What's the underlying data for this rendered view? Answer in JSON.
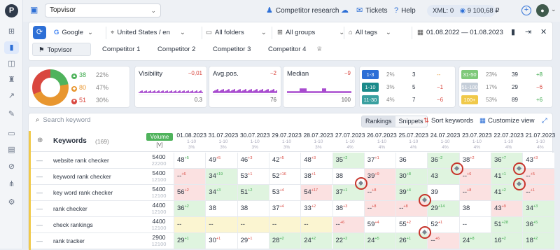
{
  "topbar": {
    "project": "Topvisor",
    "competitor_research": "Competitor research",
    "tickets": "Tickets",
    "help": "Help",
    "xml_label": "XML:",
    "xml_value": "0",
    "balance": "9 100,68 ₽"
  },
  "filters": {
    "engine": "Google",
    "region": "United States / en",
    "folders": "All folders",
    "groups": "All groups",
    "tags": "All tags",
    "date_range": "01.08.2022 — 01.08.2023",
    "competitors": [
      "Topvisor",
      "Competitor 1",
      "Competitor 2",
      "Competitor 3",
      "Competitor 4"
    ]
  },
  "summary": {
    "pie": [
      {
        "label": "38",
        "pct": "22%",
        "color": "#4fb35c"
      },
      {
        "label": "80",
        "pct": "47%",
        "color": "#e8962f"
      },
      {
        "label": "51",
        "pct": "30%",
        "color": "#d9473f"
      }
    ],
    "visibility": {
      "title": "Visibility",
      "delta": "−0,01",
      "value": "0.3"
    },
    "avgpos": {
      "title": "Avg.pos.",
      "delta": "−2",
      "value": "76"
    },
    "median": {
      "title": "Median",
      "delta": "−9",
      "value": "100"
    },
    "ranges_left": [
      {
        "badge": "1-3",
        "pct": "2%",
        "count": "3",
        "delta": "--"
      },
      {
        "badge": "1-10",
        "pct": "3%",
        "count": "5",
        "delta": "−1"
      },
      {
        "badge": "11-30",
        "pct": "4%",
        "count": "7",
        "delta": "−6"
      }
    ],
    "ranges_right": [
      {
        "badge": "31-50",
        "pct": "23%",
        "count": "39",
        "delta": "+8"
      },
      {
        "badge": "51-100",
        "pct": "17%",
        "count": "29",
        "delta": "−6"
      },
      {
        "badge": "100+",
        "pct": "53%",
        "count": "89",
        "delta": "+6"
      }
    ]
  },
  "table": {
    "search_placeholder": "Search keyword",
    "tab_rankings": "Rankings",
    "tab_snippets": "Snippets",
    "sort": "Sort keywords",
    "customize": "Customize view",
    "keywords_label": "Keywords",
    "keywords_count": "(169)",
    "volume_label": "Volume",
    "volume_sub": "[V]",
    "dates": [
      "01.08.2023",
      "31.07.2023",
      "30.07.2023",
      "29.07.2023",
      "28.07.2023",
      "27.07.2023",
      "26.07.2023",
      "25.07.2023",
      "24.07.2023",
      "23.07.2023",
      "22.07.2023",
      "21.07.2023"
    ],
    "date_subs": [
      "1-10",
      "1-10",
      "1-10",
      "1-10",
      "1-10",
      "1-10",
      "1-10",
      "1-10",
      "1-10",
      "1-10",
      "1-10",
      "1-10"
    ],
    "date_pcts": [
      "3%",
      "3%",
      "3%",
      "3%",
      "3%",
      "4%",
      "4%",
      "4%",
      "4%",
      "4%",
      "4%",
      "4%"
    ],
    "rows": [
      {
        "kw": "website rank checker",
        "vol": "5400",
        "vol2": "22200",
        "cells": [
          [
            "48",
            "+5",
            "up",
            "w"
          ],
          [
            "49",
            "+5",
            "dn",
            "w"
          ],
          [
            "46",
            "+3",
            "dn",
            "w"
          ],
          [
            "42",
            "+5",
            "dn",
            "w"
          ],
          [
            "48",
            "+3",
            "dn",
            "w"
          ],
          [
            "35",
            "+2",
            "up",
            "g"
          ],
          [
            "37",
            "+1",
            "dn",
            "w"
          ],
          [
            "36",
            "",
            "",
            "w"
          ],
          [
            "36",
            "−2",
            "up",
            "g"
          ],
          [
            "38",
            "+2",
            "dn",
            "w"
          ],
          [
            "36",
            "+7",
            "up",
            "g"
          ],
          [
            "43",
            "+3",
            "dn",
            "w"
          ]
        ]
      },
      {
        "kw": "keyword rank checker",
        "vol": "5400",
        "vol2": "12100",
        "cells": [
          [
            "--",
            "+6",
            "dn",
            "r"
          ],
          [
            "34",
            "+19",
            "up",
            "g"
          ],
          [
            "53",
            "+1",
            "dn",
            "w"
          ],
          [
            "52",
            "+16",
            "dn",
            "w"
          ],
          [
            "38",
            "+1",
            "dn",
            "w"
          ],
          [
            "38",
            "",
            "",
            "w"
          ],
          [
            "39",
            "+9",
            "dn",
            "r"
          ],
          [
            "30",
            "+8",
            "up",
            "g"
          ],
          [
            "43",
            "",
            "up",
            "g"
          ],
          [
            "--",
            "+6",
            "dn",
            "r"
          ],
          [
            "41",
            "+1",
            "up",
            "g"
          ],
          [
            "--",
            "+5",
            "dn",
            "r"
          ]
        ]
      },
      {
        "kw": "key word rank checker",
        "vol": "5400",
        "vol2": "12100",
        "cells": [
          [
            "56",
            "+2",
            "dn",
            "r"
          ],
          [
            "34",
            "+3",
            "up",
            "g"
          ],
          [
            "51",
            "+2",
            "up",
            "g"
          ],
          [
            "53",
            "+4",
            "dn",
            "w"
          ],
          [
            "54",
            "+17",
            "dn",
            "r"
          ],
          [
            "37",
            "+1",
            "up",
            "g"
          ],
          [
            "--",
            "+8",
            "dn",
            "r"
          ],
          [
            "39",
            "+4",
            "up",
            "g"
          ],
          [
            "39",
            "",
            "",
            "w"
          ],
          [
            "--",
            "+8",
            "dn",
            "r"
          ],
          [
            "41",
            "+2",
            "up",
            "g"
          ],
          [
            "--",
            "+1",
            "dn",
            "r"
          ]
        ]
      },
      {
        "kw": "rank checker",
        "vol": "4400",
        "vol2": "12100",
        "cells": [
          [
            "36",
            "+2",
            "up",
            "g"
          ],
          [
            "38",
            "",
            "",
            "w"
          ],
          [
            "38",
            "",
            "",
            "w"
          ],
          [
            "37",
            "+4",
            "dn",
            "w"
          ],
          [
            "33",
            "+2",
            "dn",
            "w"
          ],
          [
            "38",
            "+3",
            "dn",
            "w"
          ],
          [
            "--",
            "+8",
            "dn",
            "r"
          ],
          [
            "--",
            "+8",
            "dn",
            "r"
          ],
          [
            "29",
            "+14",
            "up",
            "g"
          ],
          [
            "38",
            "",
            "",
            "w"
          ],
          [
            "43",
            "+9",
            "dn",
            "r"
          ],
          [
            "34",
            "+3",
            "up",
            "g"
          ]
        ]
      },
      {
        "kw": "check rankings",
        "vol": "4400",
        "vol2": "12100",
        "cells": [
          [
            "--",
            "",
            "",
            "y"
          ],
          [
            "--",
            "",
            "",
            "y"
          ],
          [
            "--",
            "",
            "",
            "y"
          ],
          [
            "--",
            "",
            "",
            "y"
          ],
          [
            "--",
            "",
            "",
            "y"
          ],
          [
            "--",
            "+6",
            "dn",
            "r"
          ],
          [
            "59",
            "+4",
            "dn",
            "w"
          ],
          [
            "55",
            "+2",
            "dn",
            "w"
          ],
          [
            "52",
            "+1",
            "dn",
            "w"
          ],
          [
            "--",
            "",
            "",
            "w"
          ],
          [
            "51",
            "+28",
            "up",
            "g"
          ],
          [
            "36",
            "+5",
            "up",
            "g"
          ]
        ]
      },
      {
        "kw": "rank tracker",
        "vol": "2900",
        "vol2": "12100",
        "cells": [
          [
            "29",
            "+1",
            "up",
            "g"
          ],
          [
            "30",
            "+1",
            "dn",
            "w"
          ],
          [
            "29",
            "+1",
            "dn",
            "w"
          ],
          [
            "28",
            "+2",
            "up",
            "g"
          ],
          [
            "24",
            "+2",
            "up",
            "g"
          ],
          [
            "22",
            "+2",
            "up",
            "g"
          ],
          [
            "24",
            "+5",
            "up",
            "g"
          ],
          [
            "26",
            "+1",
            "up",
            "g"
          ],
          [
            "--",
            "+6",
            "dn",
            "r"
          ],
          [
            "24",
            "+8",
            "up",
            "g"
          ],
          [
            "16",
            "+2",
            "up",
            "g"
          ],
          [
            "18",
            "+2",
            "up",
            "g"
          ]
        ]
      }
    ]
  }
}
